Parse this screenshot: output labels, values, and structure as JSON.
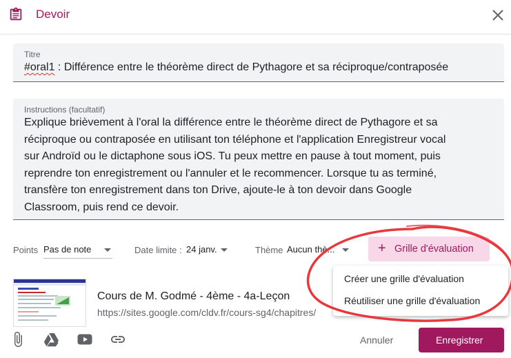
{
  "header": {
    "title": "Devoir",
    "icon": "assignment-icon",
    "close_icon": "close-icon",
    "accent_color": "#a0195f"
  },
  "title_field": {
    "label": "Titre",
    "value_tag": "#oral1",
    "value_rest": " : Différence entre le théorème direct de Pythagore et sa réciproque/contraposée"
  },
  "instructions_field": {
    "label": "Instructions (facultatif)",
    "value": "Explique brièvement à l'oral la différence entre le théorème direct de Pythagore et sa réciproque ou contraposée en utilisant ton téléphone et l'application Enregistreur vocal sur Androïd ou le dictaphone sous iOS. Tu peux mettre en pause à tout moment, puis reprendre ton enregistrement ou l'annuler et le recommencer. Lorsque tu as terminé, transfère ton enregistrement dans ton Drive, ajoute-le à ton devoir dans Google Classroom, puis rend ce devoir."
  },
  "options": {
    "points_label": "Points",
    "points_value": "Pas de note",
    "due_label": "Date limite :",
    "due_value": "24 janv.",
    "topic_label": "Thème",
    "topic_value": "Aucun thè..."
  },
  "rubric": {
    "button_label": "Grille d'évaluation",
    "menu": [
      "Créer une grille d'évaluation",
      "Réutiliser une grille d'évaluation"
    ]
  },
  "attachment": {
    "title": "Cours de M. Godmé - 4ème - 4a-Leçon",
    "url": "https://sites.google.com/cldv.fr/cours-sg4/chapitres/"
  },
  "toolbar_icons": [
    "attach-icon",
    "drive-icon",
    "youtube-icon",
    "link-icon"
  ],
  "actions": {
    "cancel_label": "Annuler",
    "save_label": "Enregistrer"
  },
  "annotation_color": "#e8383d"
}
